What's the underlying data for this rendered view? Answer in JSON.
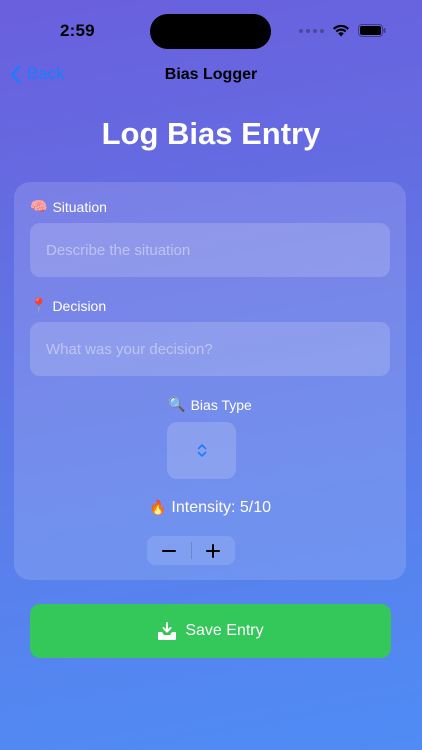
{
  "status_bar": {
    "time": "2:59",
    "icons": [
      "signal-dots",
      "wifi-icon",
      "battery-icon"
    ]
  },
  "nav": {
    "back_label": "Back",
    "title": "Bias Logger"
  },
  "page_title": "Log Bias Entry",
  "form": {
    "situation": {
      "icon": "🧠",
      "label": "Situation",
      "placeholder": "Describe the situation",
      "value": ""
    },
    "decision": {
      "icon": "📍",
      "label": "Decision",
      "placeholder": "What was your decision?",
      "value": ""
    },
    "bias_type": {
      "icon": "🔍",
      "label": "Bias Type",
      "selected": ""
    },
    "intensity": {
      "icon": "🔥",
      "label": "Intensity: 5/10",
      "value": 5,
      "max": 10
    },
    "stepper": {
      "decrement": "−",
      "increment": "+"
    }
  },
  "save_button": {
    "label": "Save Entry"
  },
  "colors": {
    "accent": "#1b7cff",
    "save": "#34c759",
    "background_top": "#6a5fdd",
    "background_bottom": "#4f8cf5"
  }
}
